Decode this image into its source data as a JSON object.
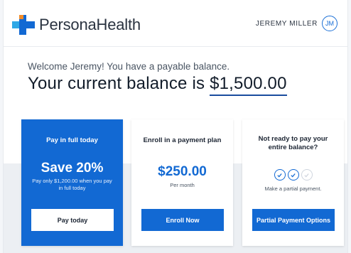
{
  "header": {
    "logo_text": "PersonaHealth",
    "user_name": "JEREMY MILLER",
    "user_initials": "JM"
  },
  "welcome": {
    "greeting": "Welcome Jeremy! You have a payable balance.",
    "balance_prefix": "Your current balance is ",
    "balance_amount": "$1,500.00"
  },
  "cards": {
    "pay_full": {
      "title": "Pay in full today",
      "headline": "Save 20%",
      "subtext": "Pay only $1,200.00 when you pay in full today",
      "button": "Pay today"
    },
    "payment_plan": {
      "title": "Enroll in a payment plan",
      "amount": "$250.00",
      "period": "Per month",
      "button": "Enroll Now"
    },
    "partial": {
      "title": "Not ready to pay your entire balance?",
      "subtext": "Make a partial payment.",
      "button": "Partial Payment Options"
    }
  },
  "colors": {
    "accent": "#1269d3",
    "logo_light_blue": "#2fa8e6",
    "logo_orange": "#f28c28",
    "underline": "#1a4c9e"
  }
}
